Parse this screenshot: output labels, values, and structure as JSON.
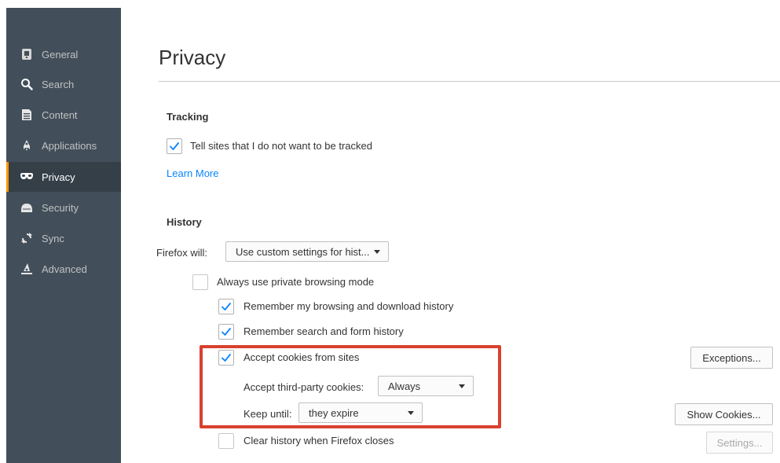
{
  "sidebar": {
    "items": [
      {
        "label": "General",
        "icon": "general-icon"
      },
      {
        "label": "Search",
        "icon": "search-icon"
      },
      {
        "label": "Content",
        "icon": "content-icon"
      },
      {
        "label": "Applications",
        "icon": "applications-icon"
      },
      {
        "label": "Privacy",
        "icon": "privacy-mask-icon"
      },
      {
        "label": "Security",
        "icon": "security-icon"
      },
      {
        "label": "Sync",
        "icon": "sync-icon"
      },
      {
        "label": "Advanced",
        "icon": "advanced-icon"
      }
    ],
    "active_index": 4,
    "accent_color": "#ff9500"
  },
  "main": {
    "title": "Privacy",
    "tracking": {
      "heading": "Tracking",
      "dnt_label": "Tell sites that I do not want to be tracked",
      "dnt_checked": true,
      "learn_more": "Learn More"
    },
    "history": {
      "heading": "History",
      "firefox_will_label": "Firefox will:",
      "firefox_will_value": "Use custom settings for hist...",
      "always_private_label": "Always use private browsing mode",
      "always_private_checked": false,
      "remember_browsing_label": "Remember my browsing and download history",
      "remember_browsing_checked": true,
      "remember_search_label": "Remember search and form history",
      "remember_search_checked": true,
      "accept_cookies_label": "Accept cookies from sites",
      "accept_cookies_checked": true,
      "third_party_label": "Accept third-party cookies:",
      "third_party_value": "Always",
      "keep_until_label": "Keep until:",
      "keep_until_value": "they expire",
      "clear_history_label": "Clear history when Firefox closes",
      "clear_history_checked": false,
      "exceptions_button": "Exceptions...",
      "show_cookies_button": "Show Cookies...",
      "settings_button": "Settings..."
    }
  },
  "colors": {
    "sidebar_bg": "#424f5a",
    "highlight": "#d9412f",
    "link": "#0a84ff",
    "check": "#0a84ff"
  }
}
